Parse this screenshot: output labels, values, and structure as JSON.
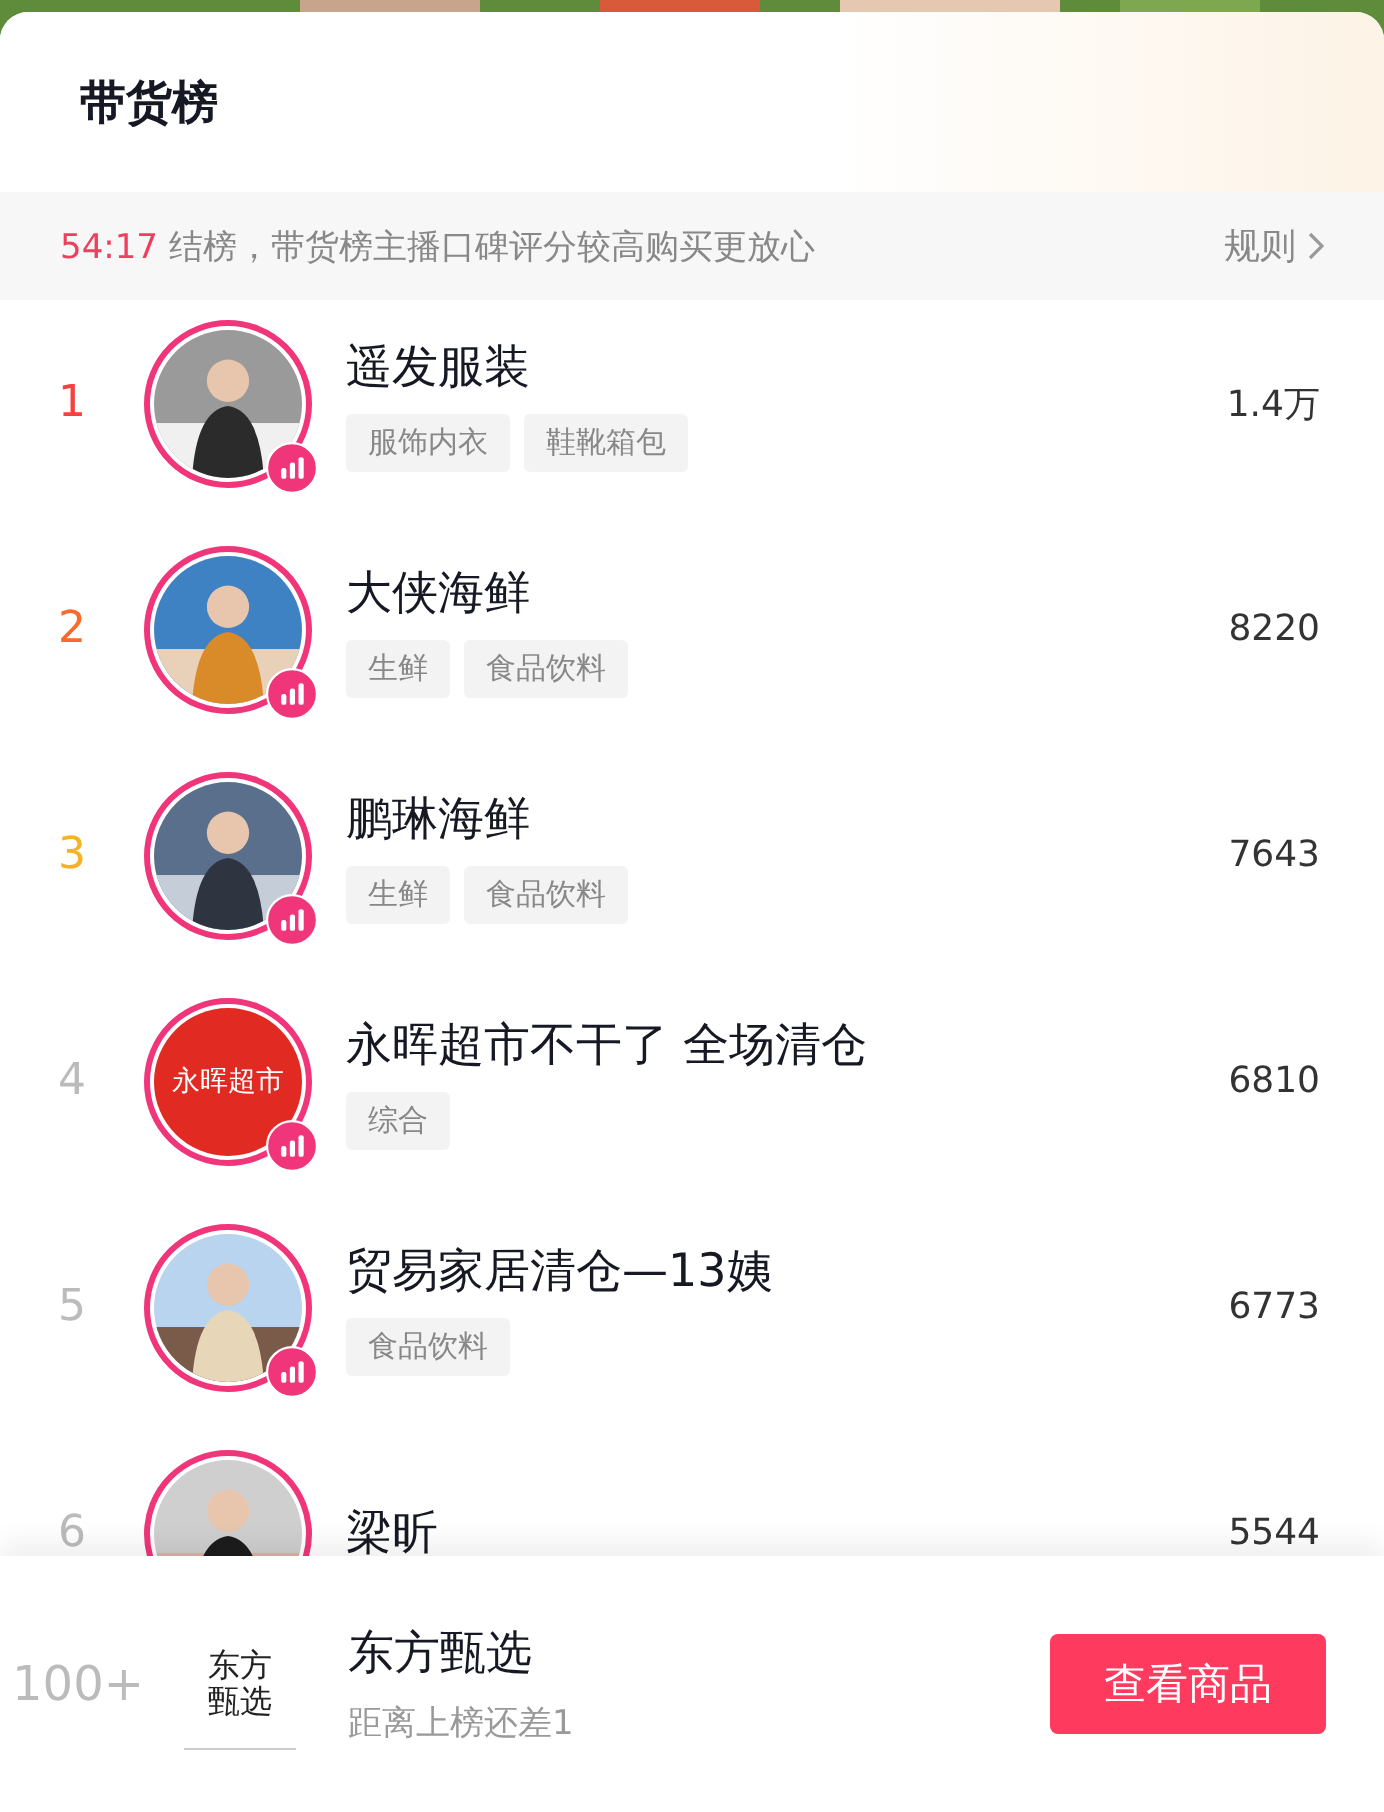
{
  "header": {
    "title": "带货榜"
  },
  "notice": {
    "countdown": "54:17",
    "text": "结榜，带货榜主播口碑评分较高购买更放心",
    "link": "规则"
  },
  "ranking": [
    {
      "rank": "1",
      "color": "#f4433f",
      "name": "遥发服装",
      "tags": [
        "服饰内衣",
        "鞋靴箱包"
      ],
      "count": "1.4万",
      "live": true,
      "avatar": {
        "kind": "picture"
      }
    },
    {
      "rank": "2",
      "color": "#fa6a2e",
      "name": "大侠海鲜",
      "tags": [
        "生鲜",
        "食品饮料"
      ],
      "count": "8220",
      "live": true,
      "avatar": {
        "kind": "picture"
      }
    },
    {
      "rank": "3",
      "color": "#f4b325",
      "name": "鹏琳海鲜",
      "tags": [
        "生鲜",
        "食品饮料"
      ],
      "count": "7643",
      "live": true,
      "avatar": {
        "kind": "picture"
      }
    },
    {
      "rank": "4",
      "color": "#bbbbbb",
      "name": "永晖超市不干了 全场清仓",
      "tags": [
        "综合"
      ],
      "count": "6810",
      "live": true,
      "avatar": {
        "kind": "text",
        "text": "永晖超市"
      }
    },
    {
      "rank": "5",
      "color": "#bbbbbb",
      "name": "贸易家居清仓—13姨",
      "tags": [
        "食品饮料"
      ],
      "count": "6773",
      "live": true,
      "avatar": {
        "kind": "picture"
      }
    },
    {
      "rank": "6",
      "color": "#bbbbbb",
      "name": "梁昕",
      "count": "5544",
      "avatar": {
        "kind": "picture"
      }
    }
  ],
  "footer": {
    "rank": "100+",
    "logo_text": "东方甄选",
    "name": "东方甄选",
    "subtitle": "距离上榜还差1",
    "button": "查看商品"
  }
}
